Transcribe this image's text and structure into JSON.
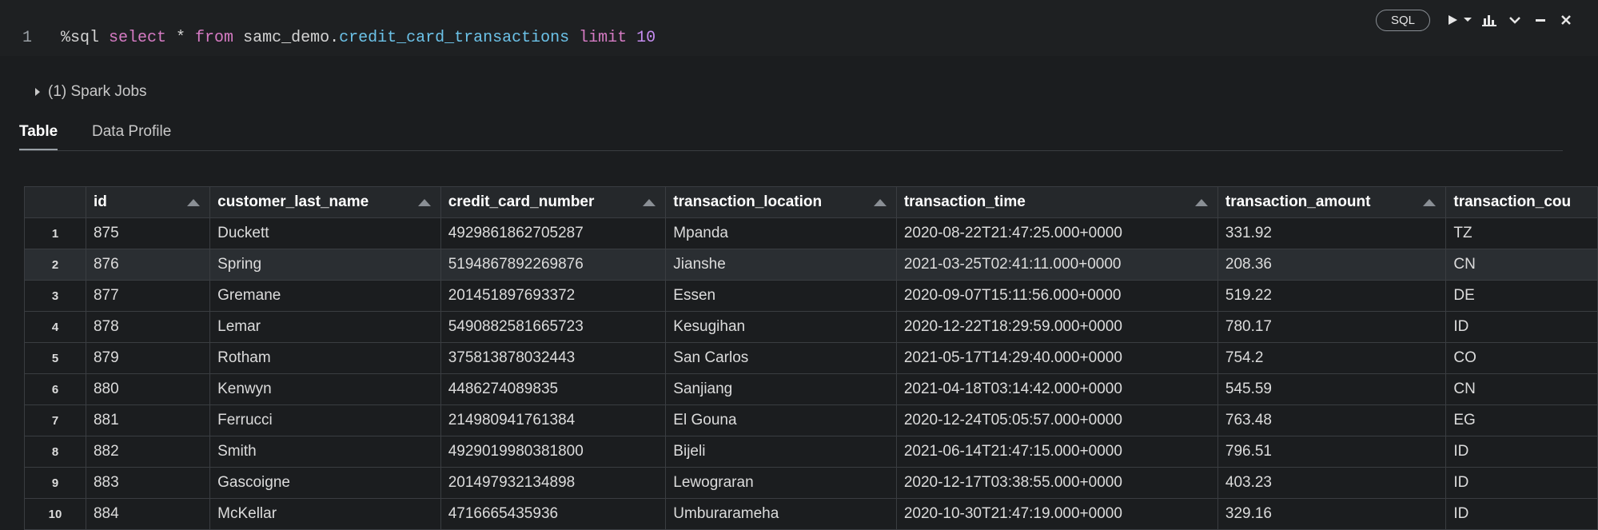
{
  "editor": {
    "line_number": "1",
    "code": {
      "magic": "%sql ",
      "kw_select": "select",
      "star": " * ",
      "kw_from": "from",
      "schema": " samc_demo.",
      "table": "credit_card_transactions",
      "kw_limit": " limit",
      "limit_value": " 10"
    },
    "language_badge": "SQL"
  },
  "toolbar_icons": [
    "run-icon",
    "chevron-down-icon",
    "chart-icon",
    "collapse-chevron-icon",
    "minimize-icon",
    "close-icon"
  ],
  "spark_jobs": "(1) Spark Jobs",
  "tabs": [
    {
      "label": "Table",
      "active": true
    },
    {
      "label": "Data Profile",
      "active": false
    }
  ],
  "table": {
    "columns": [
      "",
      "id",
      "customer_last_name",
      "credit_card_number",
      "transaction_location",
      "transaction_time",
      "transaction_amount",
      "transaction_cou"
    ],
    "rows": [
      [
        "1",
        "875",
        "Duckett",
        "4929861862705287",
        "Mpanda",
        "2020-08-22T21:47:25.000+0000",
        "331.92",
        "TZ"
      ],
      [
        "2",
        "876",
        "Spring",
        "5194867892269876",
        "Jianshe",
        "2021-03-25T02:41:11.000+0000",
        "208.36",
        "CN"
      ],
      [
        "3",
        "877",
        "Gremane",
        "201451897693372",
        "Essen",
        "2020-09-07T15:11:56.000+0000",
        "519.22",
        "DE"
      ],
      [
        "4",
        "878",
        "Lemar",
        "5490882581665723",
        "Kesugihan",
        "2020-12-22T18:29:59.000+0000",
        "780.17",
        "ID"
      ],
      [
        "5",
        "879",
        "Rotham",
        "375813878032443",
        "San Carlos",
        "2021-05-17T14:29:40.000+0000",
        "754.2",
        "CO"
      ],
      [
        "6",
        "880",
        "Kenwyn",
        "4486274089835",
        "Sanjiang",
        "2021-04-18T03:14:42.000+0000",
        "545.59",
        "CN"
      ],
      [
        "7",
        "881",
        "Ferrucci",
        "214980941761384",
        "El Gouna",
        "2020-12-24T05:05:57.000+0000",
        "763.48",
        "EG"
      ],
      [
        "8",
        "882",
        "Smith",
        "4929019980381800",
        "Bijeli",
        "2021-06-14T21:47:15.000+0000",
        "796.51",
        "ID"
      ],
      [
        "9",
        "883",
        "Gascoigne",
        "201497932134898",
        "Lewograran",
        "2020-12-17T03:38:55.000+0000",
        "403.23",
        "ID"
      ],
      [
        "10",
        "884",
        "McKellar",
        "4716665435936",
        "Umburarameha",
        "2020-10-30T21:47:19.000+0000",
        "329.16",
        "ID"
      ]
    ]
  }
}
